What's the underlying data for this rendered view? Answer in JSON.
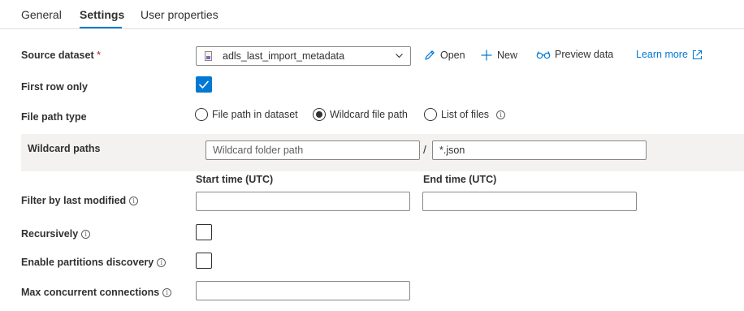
{
  "tabs": {
    "general": "General",
    "settings": "Settings",
    "user_properties": "User properties"
  },
  "source_dataset": {
    "label": "Source dataset",
    "required_mark": "*",
    "value": "adls_last_import_metadata",
    "actions": {
      "open": "Open",
      "new": "New",
      "preview": "Preview data",
      "learn_more": "Learn more"
    }
  },
  "first_row_only": {
    "label": "First row only",
    "checked": true
  },
  "file_path_type": {
    "label": "File path type",
    "options": [
      "File path in dataset",
      "Wildcard file path",
      "List of files"
    ],
    "selected": "Wildcard file path"
  },
  "wildcard_paths": {
    "label": "Wildcard paths",
    "folder_placeholder": "Wildcard folder path",
    "folder_value": "",
    "file_value": "*.json",
    "separator": "/"
  },
  "filter_modified": {
    "label": "Filter by last modified",
    "start_label": "Start time (UTC)",
    "end_label": "End time (UTC)",
    "start_value": "",
    "end_value": ""
  },
  "recursively": {
    "label": "Recursively",
    "checked": false
  },
  "partitions": {
    "label": "Enable partitions discovery",
    "checked": false
  },
  "max_connections": {
    "label": "Max concurrent connections",
    "value": ""
  },
  "colors": {
    "accent": "#0078d4",
    "required": "#a4262c",
    "band": "#f3f2f1"
  },
  "icons": {
    "info": "info-circle-icon",
    "open": "pencil-icon",
    "new": "plus-icon",
    "preview": "glasses-icon",
    "learn_more": "external-link-icon",
    "dataset": "dataset-file-icon",
    "dropdown": "chevron-down-icon",
    "check": "checkmark-icon"
  }
}
